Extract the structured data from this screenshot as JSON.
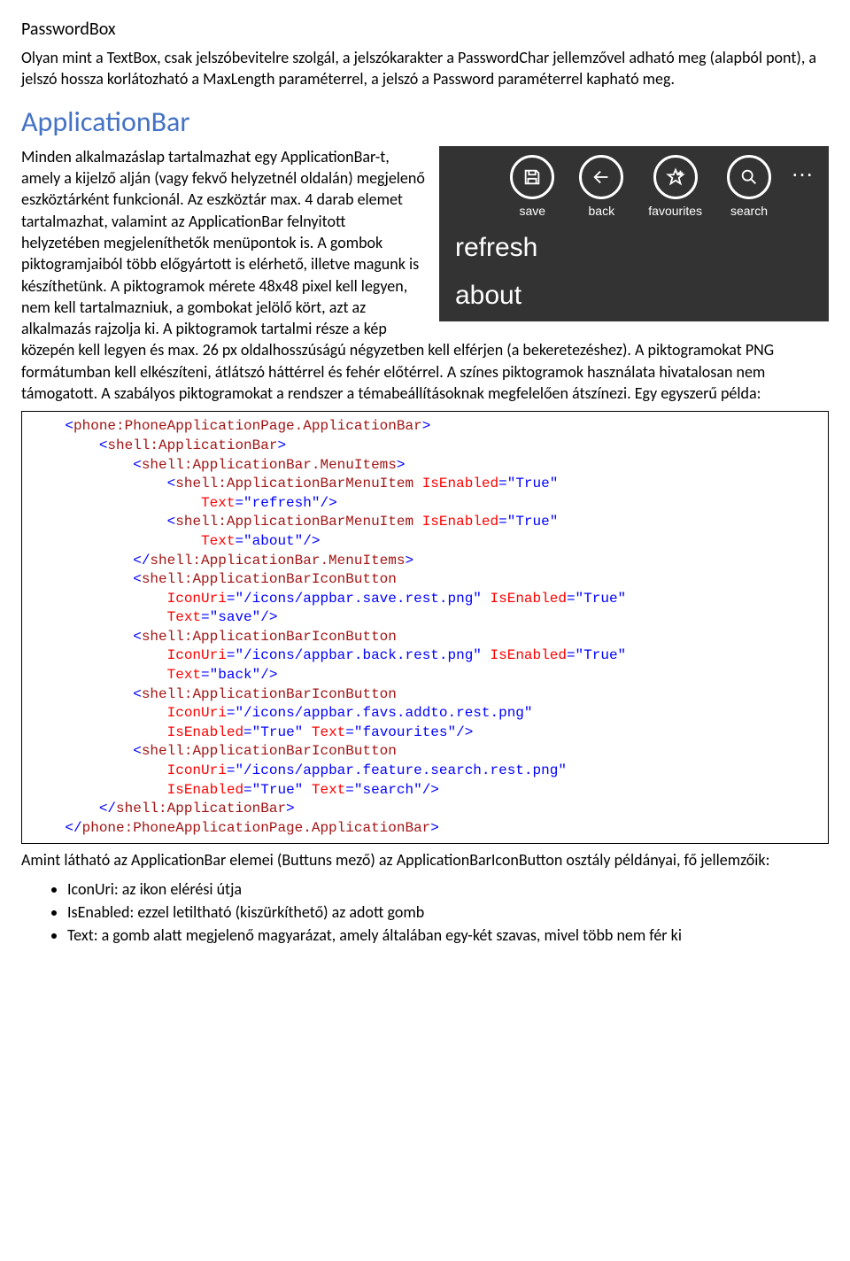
{
  "sections": {
    "passwordbox_title": "PasswordBox",
    "passwordbox_body": "Olyan mint a TextBox, csak jelszóbevitelre szolgál, a jelszókarakter a PasswordChar jellemzővel adható meg (alapból pont), a jelszó hossza korlátozható a MaxLength paraméterrel, a jelszó a Password paraméterrel kapható meg.",
    "appbar_title": "ApplicationBar",
    "appbar_body": "Minden alkalmazáslap tartalmazhat egy ApplicationBar-t, amely a kijelző alján (vagy fekvő helyzetnél oldalán) megjelenő eszköztárként funkcionál. Az eszköztár max. 4 darab elemet tartalmazhat, valamint az ApplicationBar felnyitott helyzetében megjeleníthetők menüpontok is. A gombok piktogramjaiból több előgyártott is elérhető, illetve magunk is készíthetünk. A piktogramok mérete 48x48 pixel kell legyen, nem kell tartalmazniuk, a gombokat jelölő kört, azt az alkalmazás rajzolja ki. A piktogramok tartalmi része a kép közepén kell legyen és max. 26 px oldalhosszúságú négyzetben kell elférjen (a bekeretezéshez). A piktogramokat PNG formátumban kell elkészíteni, átlátszó háttérrel és fehér előtérrel. A színes piktogramok használata hivatalosan nem támogatott. A szabályos piktogramokat a rendszer a témabeállításoknak megfelelően átszínezi. Egy egyszerű példa:",
    "post_code": "Amint látható az ApplicationBar elemei (Buttuns mező) az ApplicationBarIconButton osztály példányai, fő jellemzőik:",
    "bullets": [
      "IconUri: az ikon elérési útja",
      "IsEnabled: ezzel letiltható (kiszürkíthető) az adott gomb",
      "Text: a gomb alatt megjelenő magyarázat, amely általában egy-két szavas, mivel több nem fér ki"
    ]
  },
  "fig": {
    "buttons": [
      {
        "label": "save"
      },
      {
        "label": "back"
      },
      {
        "label": "favourites"
      },
      {
        "label": "search"
      }
    ],
    "menu": [
      "refresh",
      "about"
    ]
  },
  "code": {
    "open_page": "phone:PhoneApplicationPage.ApplicationBar",
    "open_bar": "shell:ApplicationBar",
    "open_menu": "shell:ApplicationBar.MenuItems",
    "menuitem_tag": "shell:ApplicationBarMenuItem",
    "iconbtn_tag": "shell:ApplicationBarIconButton",
    "attr_isenabled": "IsEnabled",
    "attr_text": "Text",
    "attr_iconuri": "IconUri",
    "val_true": "\"True\"",
    "val_refresh": "\"refresh\"",
    "val_about": "\"about\"",
    "val_save": "\"save\"",
    "val_back": "\"back\"",
    "val_fav": "\"favourites\"",
    "val_search": "\"search\"",
    "uri_save": "\"/icons/appbar.save.rest.png\"",
    "uri_back": "\"/icons/appbar.back.rest.png\"",
    "uri_fav": "\"/icons/appbar.favs.addto.rest.png\"",
    "uri_search": "\"/icons/appbar.feature.search.rest.png\""
  }
}
